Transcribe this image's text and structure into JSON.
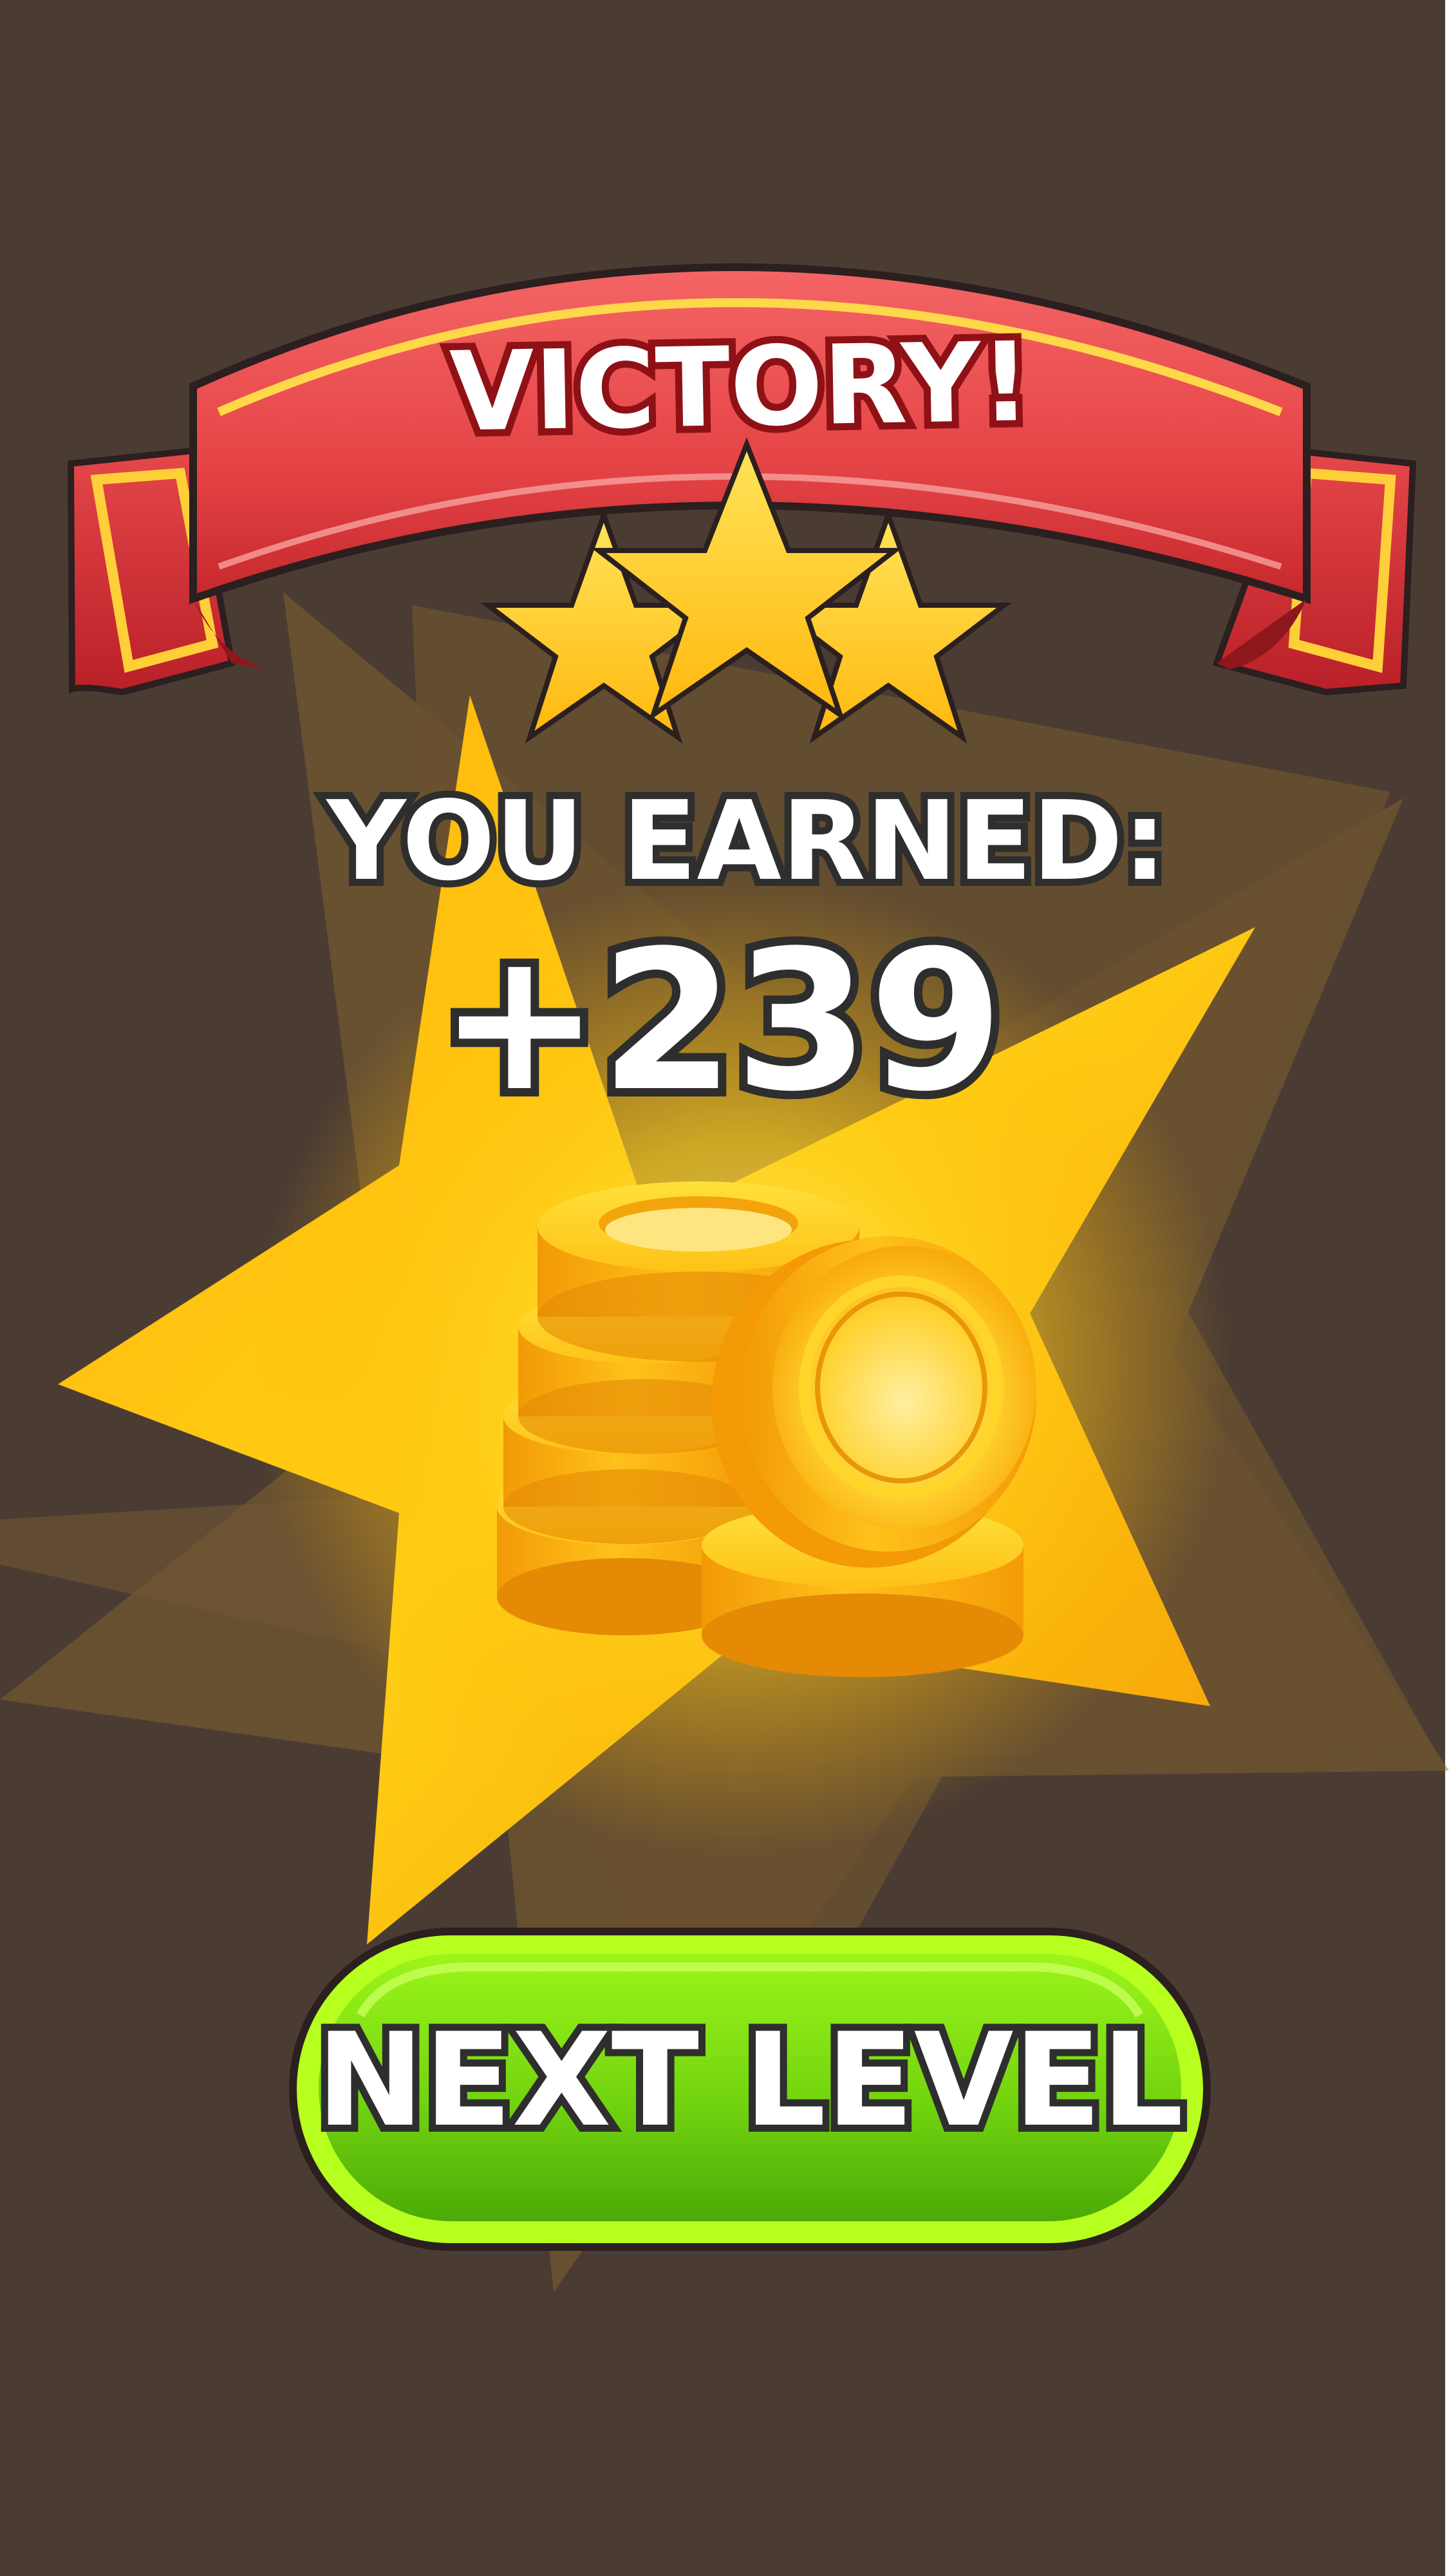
{
  "banner": {
    "title": "VICTORY!"
  },
  "rating": {
    "stars_earned": 3,
    "stars_total": 3
  },
  "reward": {
    "heading": "YOU EARNED:",
    "amount": "+239",
    "icon": "coin-stack-icon"
  },
  "actions": {
    "next_level_label": "NEXT LEVEL"
  },
  "colors": {
    "background": "#4B3C33",
    "ribbon": "#E2413F",
    "ribbon_trim": "#FFD23A",
    "star": "#FFC61E",
    "coin": "#FFB20E",
    "button": "#6FD411",
    "button_border": "#B6FF1E",
    "text_stroke": "#2E2E2E"
  }
}
